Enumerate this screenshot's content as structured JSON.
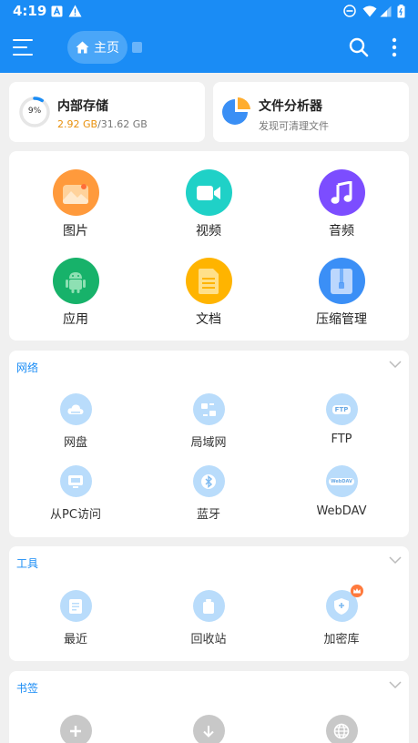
{
  "status_bar": {
    "time": "4:19"
  },
  "app_bar": {
    "home_label": "主页"
  },
  "storage": {
    "title": "内部存储",
    "percent_label": "9%",
    "used_fraction": 0.092,
    "used": "2.92 GB",
    "total": "/31.62 GB"
  },
  "analyzer": {
    "title": "文件分析器",
    "subtitle": "发现可清理文件"
  },
  "categories": [
    {
      "label": "图片",
      "color": "#ff9a3c"
    },
    {
      "label": "视频",
      "color": "#1fd1c7"
    },
    {
      "label": "音频",
      "color": "#7c4dff"
    },
    {
      "label": "应用",
      "color": "#17b26a"
    },
    {
      "label": "文档",
      "color": "#ffb400"
    },
    {
      "label": "压缩管理",
      "color": "#3b8ff6"
    }
  ],
  "network": {
    "title": "网络",
    "items": [
      {
        "label": "网盘",
        "icon": "cloud-drive-icon"
      },
      {
        "label": "局域网",
        "icon": "lan-icon"
      },
      {
        "label": "FTP",
        "icon": "ftp-icon",
        "badge": "FTP"
      },
      {
        "label": "从PC访问",
        "icon": "pc-access-icon"
      },
      {
        "label": "蓝牙",
        "icon": "bluetooth-icon"
      },
      {
        "label": "WebDAV",
        "icon": "webdav-icon",
        "badge": "WebDAV"
      }
    ]
  },
  "tools": {
    "title": "工具",
    "items": [
      {
        "label": "最近",
        "icon": "recent-icon"
      },
      {
        "label": "回收站",
        "icon": "recycle-bin-icon"
      },
      {
        "label": "加密库",
        "icon": "vault-icon"
      }
    ]
  },
  "bookmarks": {
    "title": "书签"
  },
  "colors": {
    "primary": "#1a8cf5",
    "used_text": "#e8900c",
    "bubble": "#b9dcfb",
    "bubble_icon": "#ffffff",
    "crown": "#ff7a3d"
  }
}
